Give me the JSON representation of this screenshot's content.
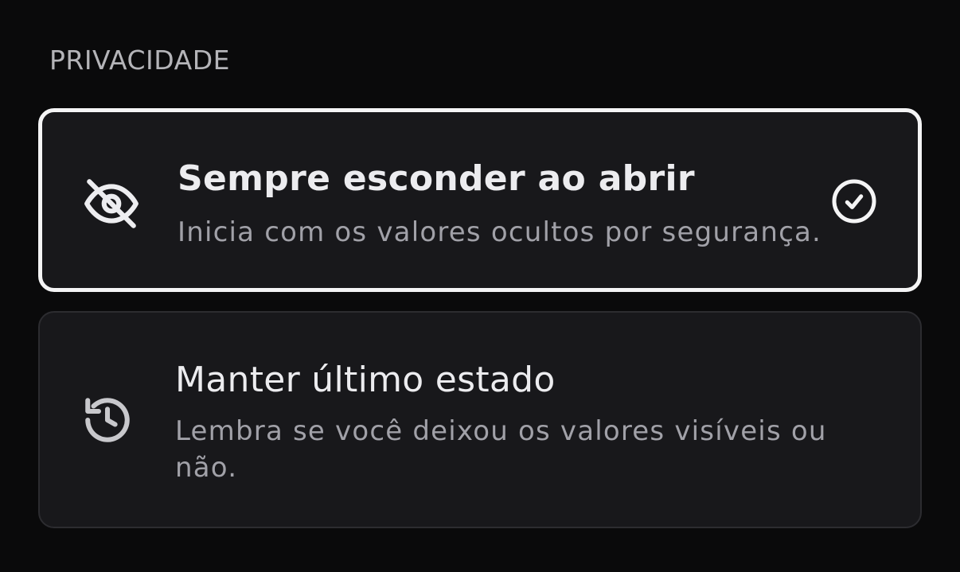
{
  "section": {
    "title": "PRIVACIDADE"
  },
  "options": [
    {
      "title": "Sempre esconder ao abrir",
      "description": "Inicia com os valores ocultos por segurança.",
      "icon": "eye-off-icon",
      "selected": true
    },
    {
      "title": "Manter último estado",
      "description": "Lembra se você deixou os valores visíveis ou não.",
      "icon": "history-icon",
      "selected": false
    }
  ],
  "colors": {
    "background": "#0a0a0b",
    "card": "#18181b",
    "selected_border": "#f4f4f5",
    "card_border": "#2c2c30",
    "title_text": "#ececef",
    "secondary_text": "#a1a1a8"
  }
}
